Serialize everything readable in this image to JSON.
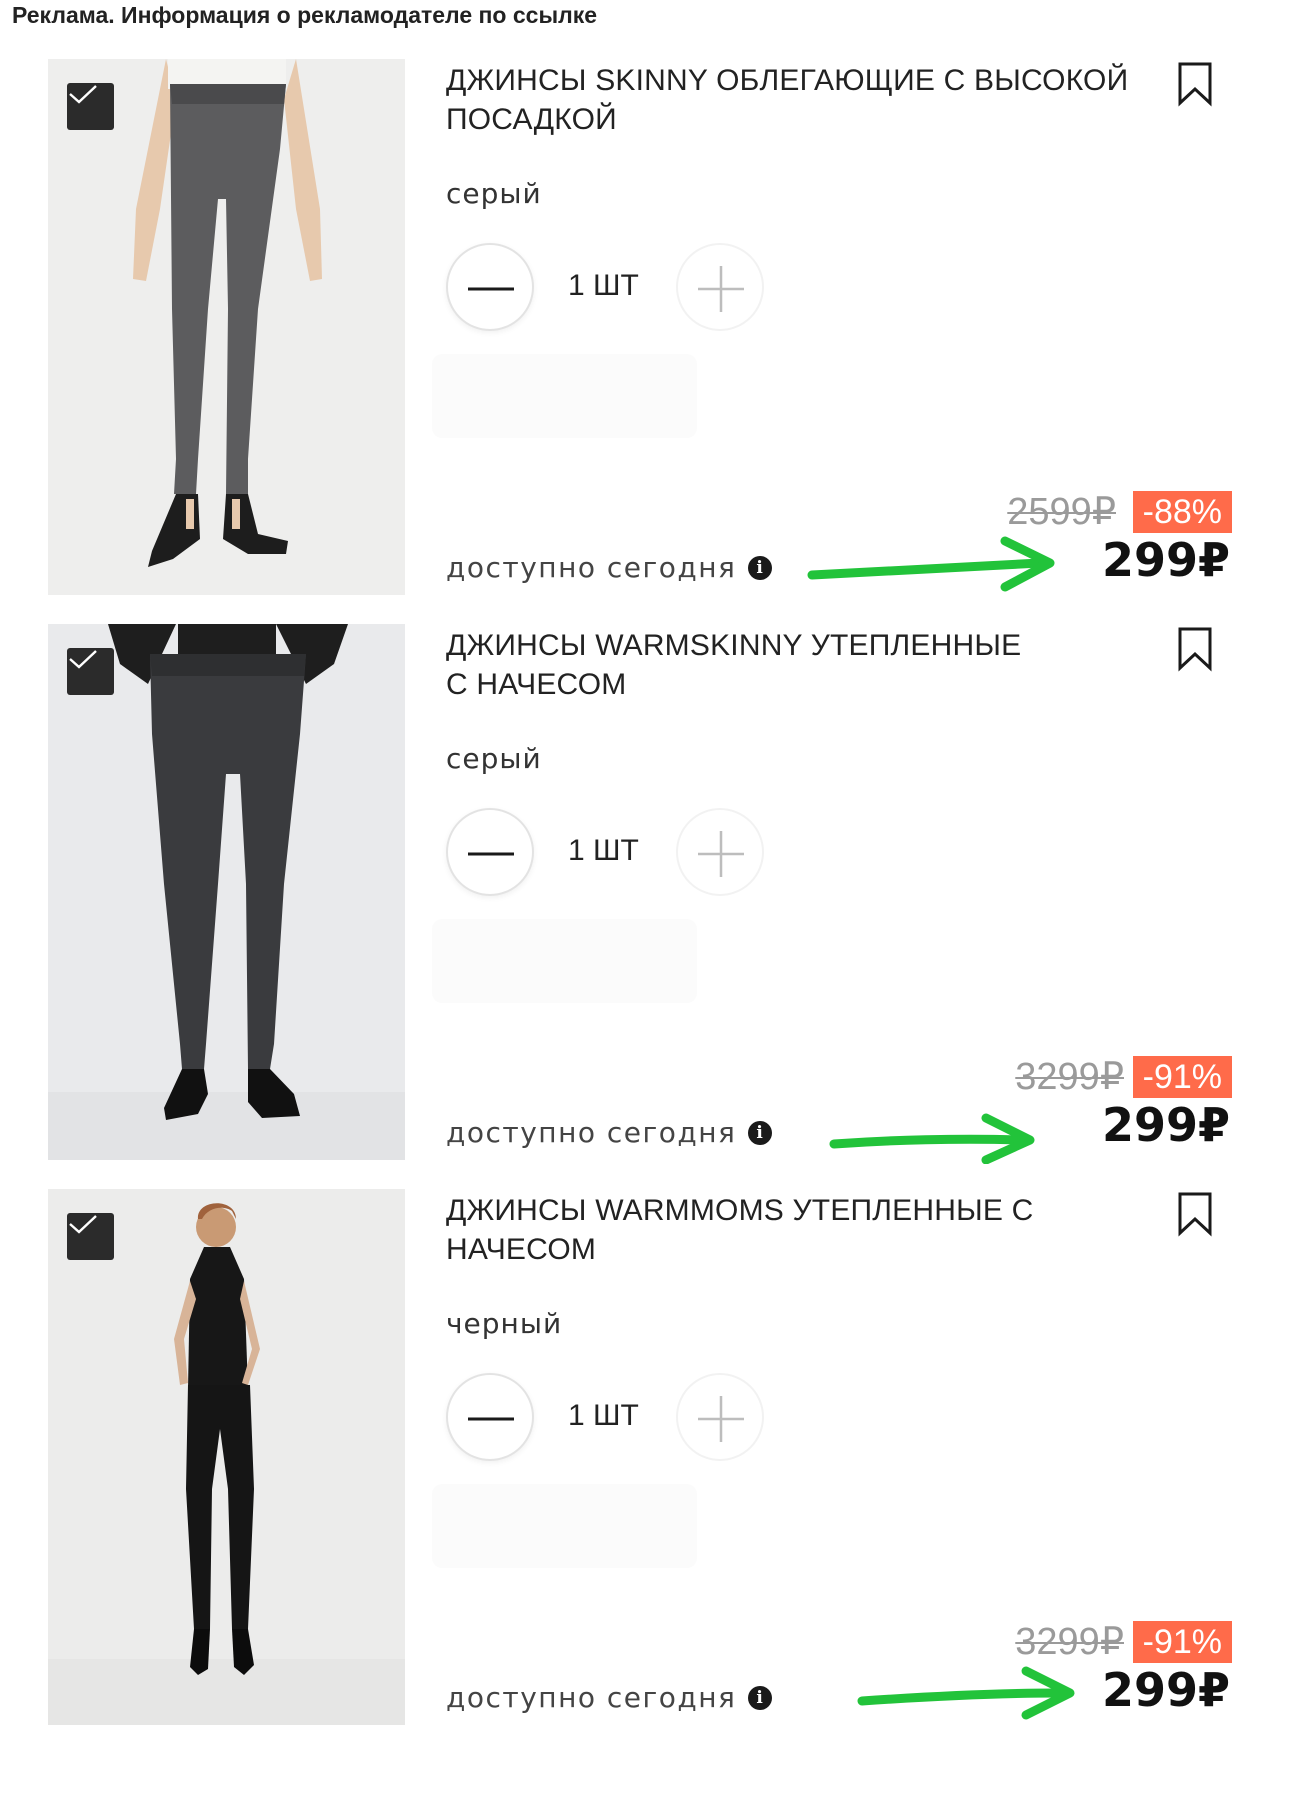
{
  "ad_banner": "Реклама. Информация о рекламодателе по ссылке",
  "accent_color": "#ff6b4a",
  "annotation_color": "#22c33a",
  "items": [
    {
      "title": "ДЖИНСЫ SKINNY ОБЛЕГАЮЩИЕ С ВЫСОКОЙ ПОСАДКОЙ",
      "color": "серый",
      "quantity": "1 ШТ",
      "old_price": "2599₽",
      "discount": "-88%",
      "price": "299₽",
      "availability": "доступно сегодня",
      "selected": true,
      "photo_icon": "grey-skinny-jeans-photo"
    },
    {
      "title": "ДЖИНСЫ WARMSKINNY УТЕПЛЕННЫЕ С НАЧЕСОМ",
      "color": "серый",
      "quantity": "1 ШТ",
      "old_price": "3299₽",
      "discount": "-91%",
      "price": "299₽",
      "availability": "доступно сегодня",
      "selected": true,
      "photo_icon": "dark-grey-jeans-photo"
    },
    {
      "title": "ДЖИНСЫ WARMMOMS УТЕПЛЕННЫЕ С НАЧЕСОМ",
      "color": "черный",
      "quantity": "1 ШТ",
      "old_price": "3299₽",
      "discount": "-91%",
      "price": "299₽",
      "availability": "доступно сегодня",
      "selected": true,
      "photo_icon": "black-mom-jeans-photo"
    }
  ]
}
